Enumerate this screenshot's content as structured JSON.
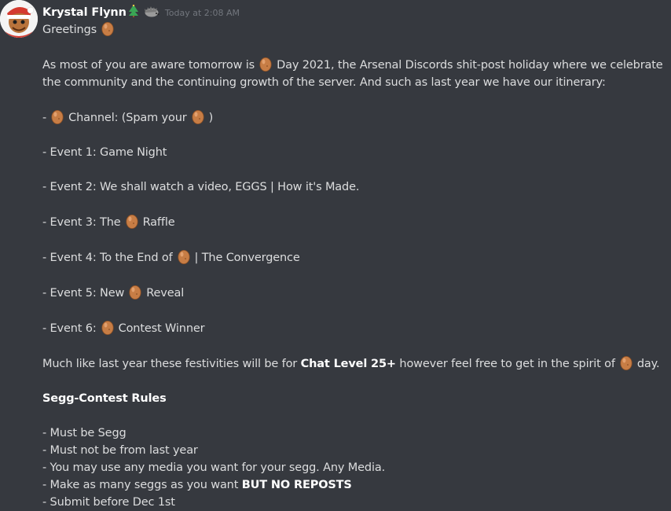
{
  "message": {
    "author": "Krystal Flynn",
    "author_emoji": "tree-emoji",
    "badge_icon": "hedgehog-badge-icon",
    "timestamp": "Today at 2:08 AM",
    "greeting": "Greetings",
    "intro_1": "As most of you are aware tomorrow is",
    "intro_2": "Day 2021, the Arsenal Discords shit-post holiday where we celebrate",
    "intro_3": "the community and the continuing growth of the server. And such as last year we have our itinerary:",
    "channel_prefix": "-",
    "channel_text": "Channel: (Spam your",
    "channel_close": ")",
    "event1": "- Event 1: Game Night",
    "event2": "- Event 2: We shall watch a video, EGGS | How it's Made.",
    "event3_a": "- Event 3: The",
    "event3_b": "Raffle",
    "event4_a": "- Event 4: To the End of",
    "event4_b": "| The Convergence",
    "event5_a": "- Event 5: New",
    "event5_b": "Reveal",
    "event6_a": "- Event 6:",
    "event6_b": "Contest Winner",
    "festive_a": "Much like last year these festivities will be for",
    "festive_bold": "Chat Level 25+",
    "festive_b": "however feel free to get in the spirit of",
    "festive_c": "day.",
    "rules_title": "Segg-Contest Rules",
    "rule1": "- Must be Segg",
    "rule2": "- Must not be from last year",
    "rule3": "- You may use any media you want for your segg. Any Media.",
    "rule4_a": "- Make as many seggs as you want",
    "rule4_bold": "BUT NO REPOSTS",
    "rule5": "- Submit before Dec 1st"
  },
  "colors": {
    "background": "#36393f",
    "text": "#dcddde",
    "username": "#ffffff",
    "timestamp": "#72767d",
    "egg": "#c77d45"
  }
}
